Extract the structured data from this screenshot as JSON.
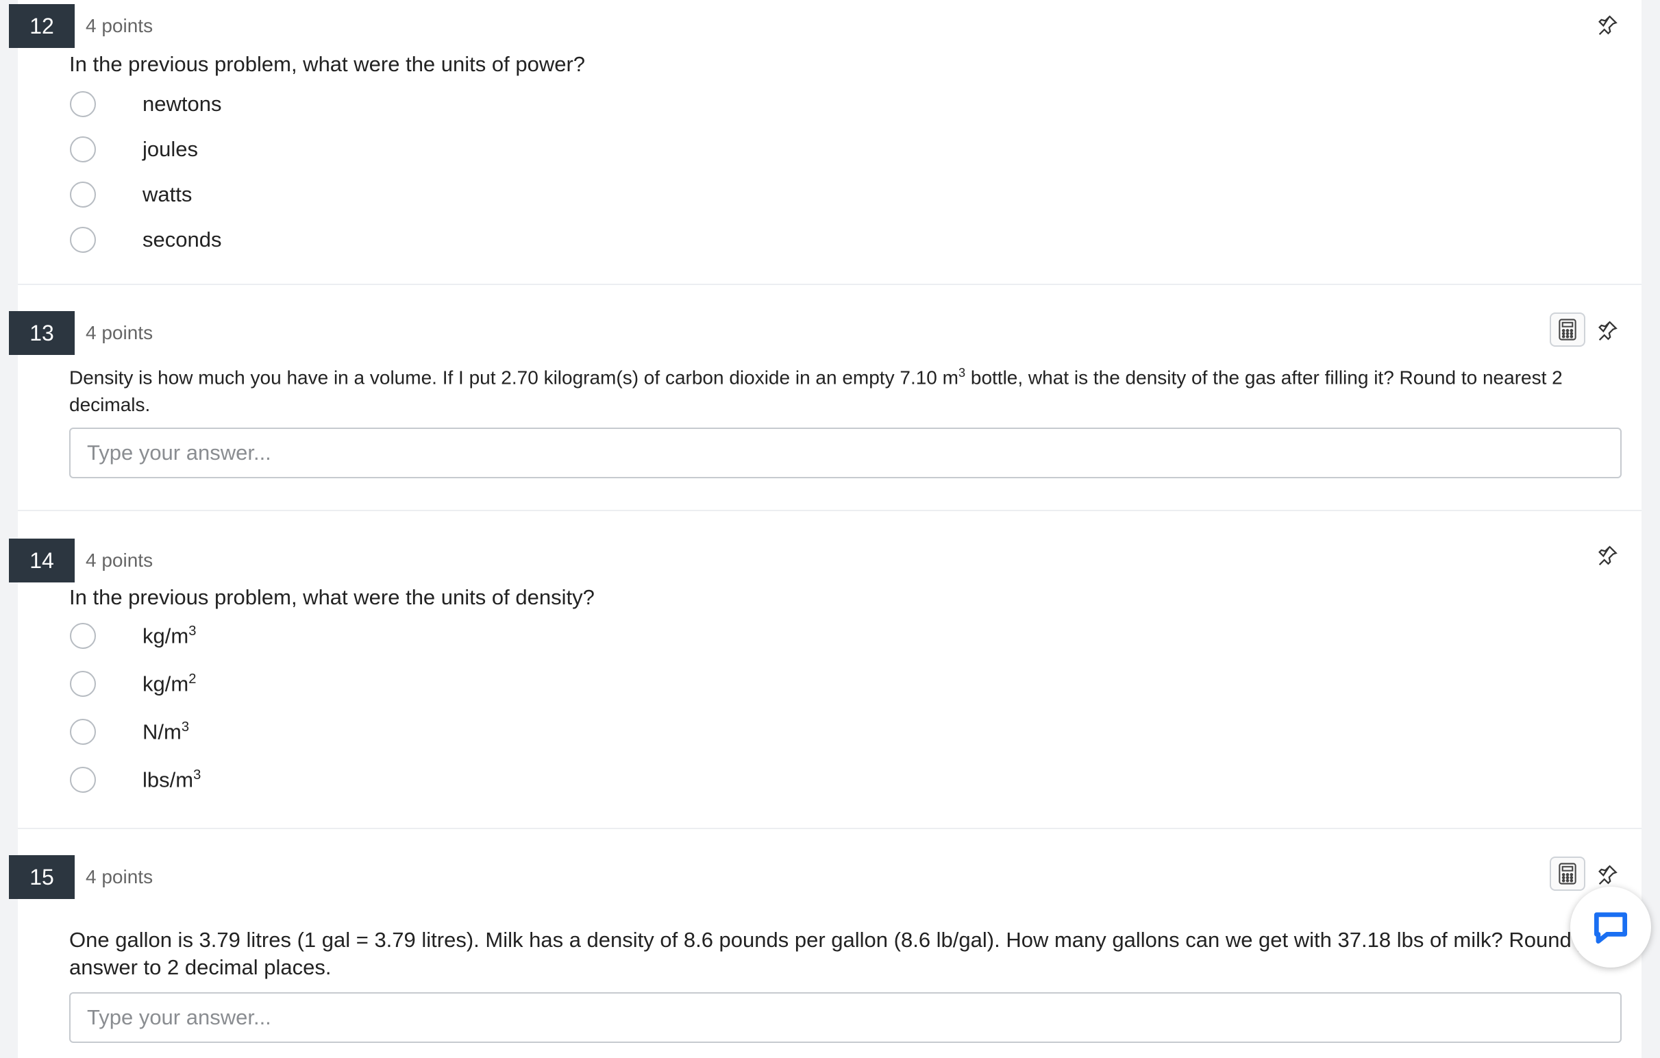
{
  "questions": [
    {
      "number": "12",
      "points": "4 points",
      "prompt": "In the previous problem, what were the units of power?",
      "options": [
        {
          "base": "newtons",
          "sup": ""
        },
        {
          "base": "joules",
          "sup": ""
        },
        {
          "base": "watts",
          "sup": ""
        },
        {
          "base": "seconds",
          "sup": ""
        }
      ],
      "icons": [
        "pin-icon"
      ]
    },
    {
      "number": "13",
      "points": "4 points",
      "prompt_parts": {
        "before": "Density is how much you have in a volume. If I put 2.70 kilogram(s) of carbon dioxide in an empty 7.10 m",
        "sup": "3",
        "after": " bottle, what is the density of the gas after filling it? Round to nearest 2 decimals."
      },
      "answer_placeholder": "Type your answer...",
      "icons": [
        "calculator-icon",
        "pin-icon"
      ]
    },
    {
      "number": "14",
      "points": "4 points",
      "prompt": "In the previous problem, what were the units of density?",
      "options": [
        {
          "base": "kg/m",
          "sup": "3"
        },
        {
          "base": "kg/m",
          "sup": "2"
        },
        {
          "base": "N/m",
          "sup": "3"
        },
        {
          "base": "lbs/m",
          "sup": "3"
        }
      ],
      "icons": [
        "pin-icon"
      ]
    },
    {
      "number": "15",
      "points": "4 points",
      "prompt": "One gallon is 3.79 litres (1 gal = 3.79 litres). Milk has a density of 8.6 pounds per gallon (8.6 lb/gal). How many gallons can we get with 37.18 lbs of milk? Round your answer to 2 decimal places.",
      "answer_placeholder": "Type your answer...",
      "icons": [
        "calculator-icon",
        "pin-icon"
      ]
    }
  ],
  "chat_widget": {
    "icon": "chat-bubble-icon",
    "color": "#1a6ff2"
  },
  "colors": {
    "question_number_bg": "#2c3640",
    "background": "#ffffff"
  }
}
